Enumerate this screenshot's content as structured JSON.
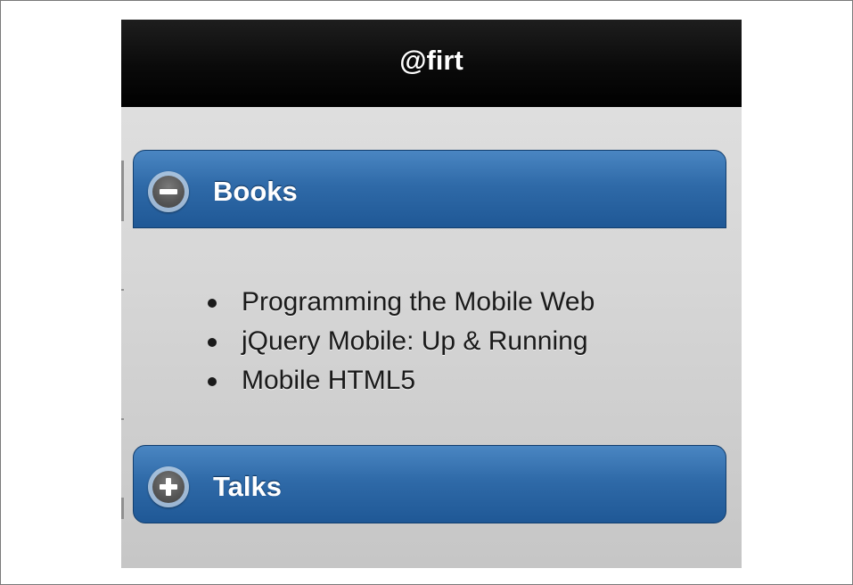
{
  "header": {
    "title": "@firt"
  },
  "sections": [
    {
      "label": "Books",
      "state": "expanded",
      "icon": "minus-circle-icon",
      "items": [
        "Programming the Mobile Web",
        "jQuery Mobile: Up & Running",
        "Mobile HTML5"
      ]
    },
    {
      "label": "Talks",
      "state": "collapsed",
      "icon": "plus-circle-icon"
    }
  ],
  "colors": {
    "header_bar": "#000000",
    "accent_blue": "#2f6aa8",
    "content_background": "#d7d7d7"
  }
}
